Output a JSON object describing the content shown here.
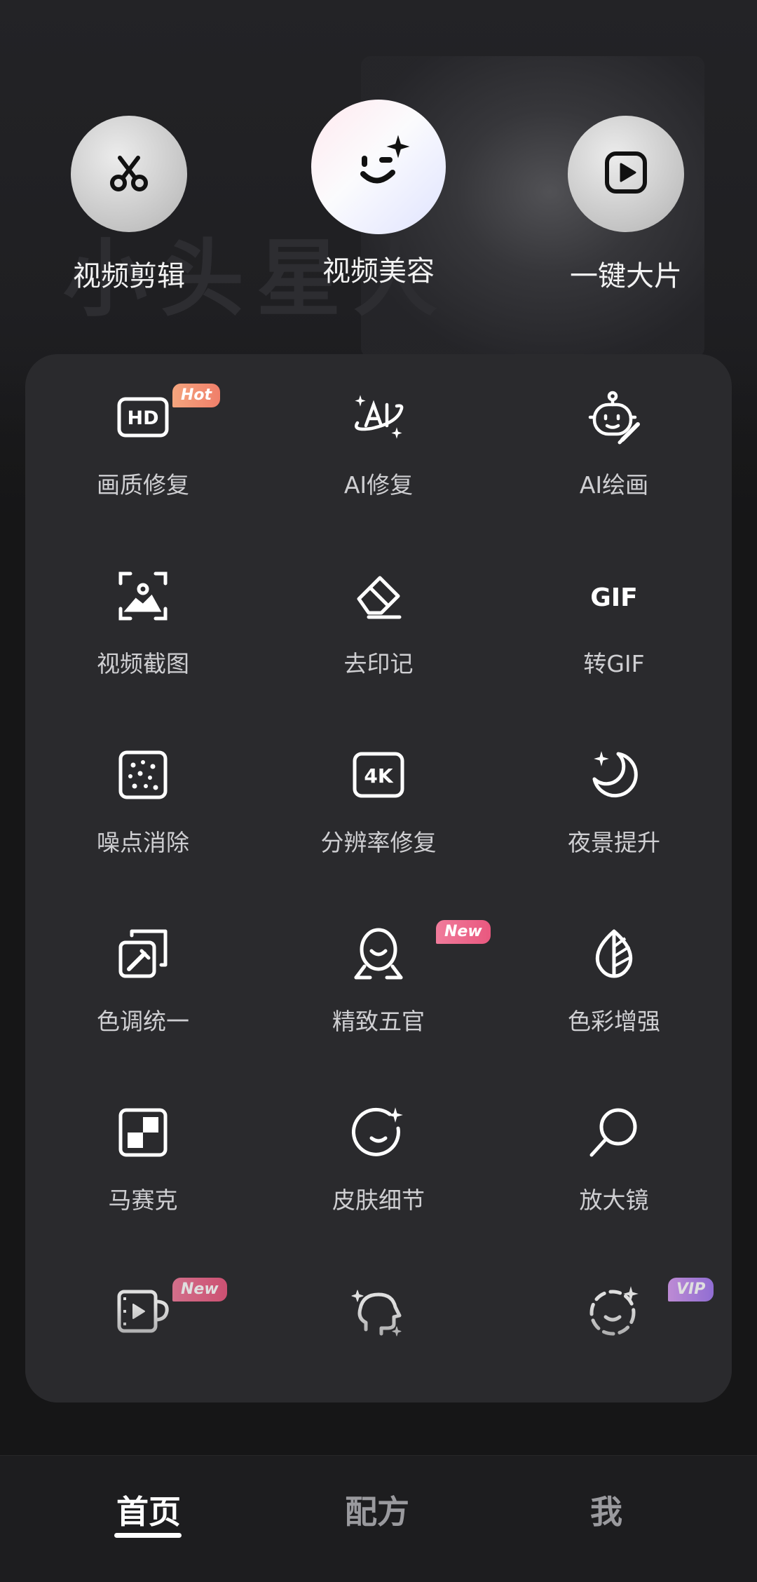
{
  "quick_actions": [
    {
      "label": "视频剪辑",
      "icon": "scissors-icon"
    },
    {
      "label": "视频美容",
      "icon": "smile-sparkle-icon"
    },
    {
      "label": "一键大片",
      "icon": "play-square-icon"
    }
  ],
  "tools": [
    {
      "label": "画质修复",
      "icon": "hd-icon",
      "badge": "Hot"
    },
    {
      "label": "AI修复",
      "icon": "ai-sparkle-icon"
    },
    {
      "label": "AI绘画",
      "icon": "robot-brush-icon"
    },
    {
      "label": "视频截图",
      "icon": "screenshot-frame-icon"
    },
    {
      "label": "去印记",
      "icon": "eraser-icon"
    },
    {
      "label": "转GIF",
      "icon": "gif-icon"
    },
    {
      "label": "噪点消除",
      "icon": "noise-dots-icon"
    },
    {
      "label": "分辨率修复",
      "icon": "4k-icon"
    },
    {
      "label": "夜景提升",
      "icon": "moon-star-icon"
    },
    {
      "label": "色调统一",
      "icon": "color-picker-icon"
    },
    {
      "label": "精致五官",
      "icon": "face-outline-icon",
      "badge": "New"
    },
    {
      "label": "色彩增强",
      "icon": "leaf-half-icon"
    },
    {
      "label": "马赛克",
      "icon": "mosaic-icon"
    },
    {
      "label": "皮肤细节",
      "icon": "face-sparkle-icon"
    },
    {
      "label": "放大镜",
      "icon": "magnifier-icon"
    },
    {
      "label": "",
      "icon": "film-cup-icon",
      "badge": "New"
    },
    {
      "label": "",
      "icon": "head-sparkle-icon"
    },
    {
      "label": "",
      "icon": "dashed-face-icon",
      "badge": "VIP"
    }
  ],
  "background": {
    "text": "小头星人"
  },
  "nav": {
    "items": [
      {
        "label": "首页",
        "active": true
      },
      {
        "label": "配方",
        "active": false
      },
      {
        "label": "我",
        "active": false
      }
    ]
  }
}
